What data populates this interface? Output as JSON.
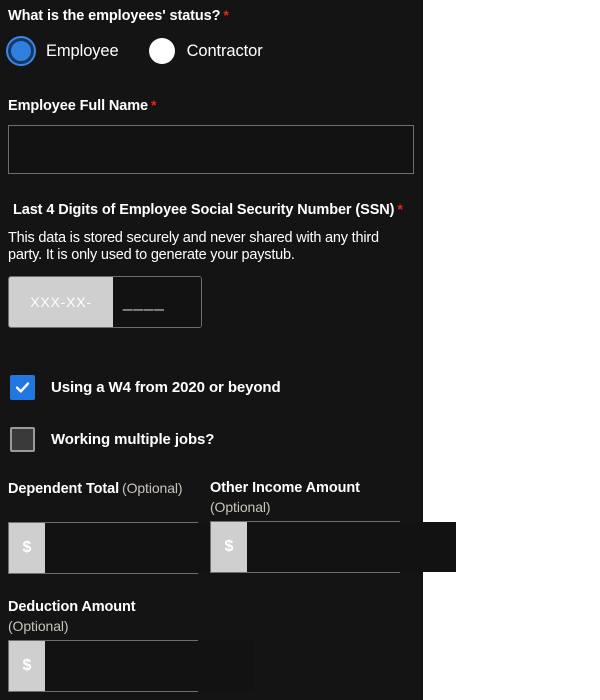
{
  "form": {
    "status_question": {
      "label": "What is the employees' status?",
      "required_marker": "*",
      "options": [
        {
          "label": "Employee",
          "selected": true
        },
        {
          "label": "Contractor",
          "selected": false
        }
      ]
    },
    "full_name": {
      "label": "Employee Full Name",
      "required_marker": "*",
      "value": "",
      "placeholder": ""
    },
    "ssn": {
      "label": "Last 4 Digits of Employee Social Security Number (SSN)",
      "required_marker": "*",
      "help_text": "This data is stored securely and never shared with any third party. It is only used to generate your paystub.",
      "prefix": "XXX-XX-",
      "placeholder": "____",
      "value": ""
    },
    "w4_checkbox": {
      "label": "Using a W4 from 2020 or beyond",
      "checked": true
    },
    "multiple_jobs_checkbox": {
      "label": "Working multiple jobs?",
      "checked": false
    },
    "dependent_total": {
      "label": "Dependent Total",
      "optional_text": "(Optional)",
      "prefix": "$",
      "value": "",
      "placeholder": ""
    },
    "other_income": {
      "label": "Other Income Amount",
      "optional_text": "(Optional)",
      "prefix": "$",
      "value": "",
      "placeholder": ""
    },
    "deduction_amount": {
      "label": "Deduction Amount",
      "optional_text": "(Optional)",
      "prefix": "$",
      "value": "",
      "placeholder": ""
    }
  },
  "colors": {
    "panel_background": "#141414",
    "accent_blue": "#2176e0",
    "required_red": "#e8251f",
    "prefix_gray": "#cfcfcf",
    "optional_text": "#c9c4bb",
    "page_background": "#ffffff"
  }
}
